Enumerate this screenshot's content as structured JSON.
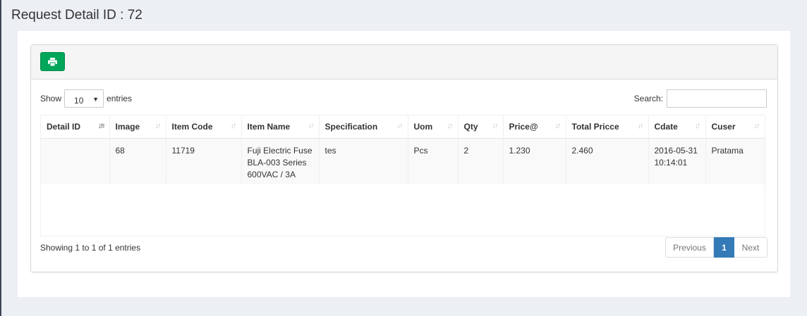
{
  "page": {
    "title": "Request Detail ID : 72"
  },
  "toolbar": {
    "print_icon": "print-icon"
  },
  "length": {
    "show": "Show",
    "value": "10",
    "entries": "entries"
  },
  "search": {
    "label": "Search:",
    "value": "",
    "placeholder": ""
  },
  "table": {
    "headers": [
      "Detail ID",
      "Image",
      "Item Code",
      "Item Name",
      "Specification",
      "Uom",
      "Qty",
      "Price@",
      "Total Pricce",
      "Cdate",
      "Cuser"
    ],
    "rows": [
      {
        "detail_id": "",
        "image": "68",
        "item_code": "11719",
        "item_name_l1": "Fuji Electric Fuse",
        "item_name_l2": "BLA-003 Series",
        "item_name_l3": "600VAC / 3A",
        "specification": "tes",
        "uom": "Pcs",
        "qty": "2",
        "price": "1.230",
        "total": "2.460",
        "cdate_l1": "2016-05-31",
        "cdate_l2": "10:14:01",
        "cuser": "Pratama"
      }
    ]
  },
  "footer": {
    "info": "Showing 1 to 1 of 1 entries"
  },
  "pagination": {
    "previous": "Previous",
    "page": "1",
    "next": "Next"
  },
  "colors": {
    "success": "#00a65a",
    "primary": "#337ab7",
    "background": "#ecf0f5"
  }
}
